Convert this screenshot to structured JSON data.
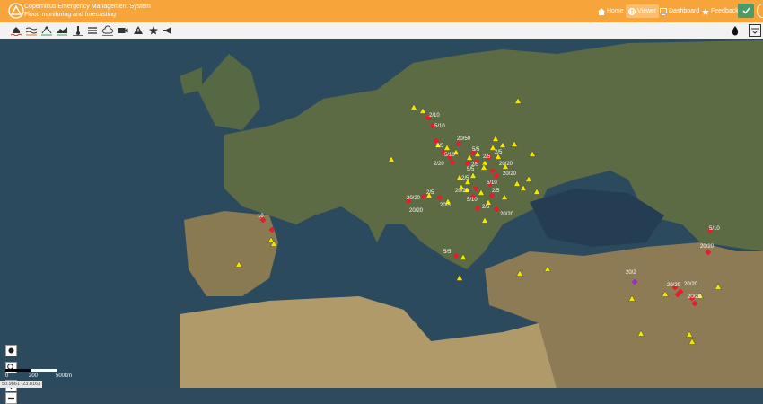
{
  "header": {
    "title": "Copernicus Emergency Management System",
    "subtitle": "Flood monitoring and forecasting",
    "nav": [
      {
        "label": "Home",
        "icon": "home-icon"
      },
      {
        "label": "Viewer",
        "icon": "globe-icon"
      },
      {
        "label": "Dashboard",
        "icon": "monitor-icon"
      },
      {
        "label": "Feedback",
        "icon": "star-icon"
      }
    ],
    "colors": {
      "header_bg": "#f7a53a",
      "check_bg": "#4c9a66"
    }
  },
  "toolbar": {
    "icons": [
      "flood-icon",
      "waves-icon",
      "radar-icon",
      "landslide-icon",
      "thermometer-icon",
      "layers-list-icon",
      "cloud-icon",
      "camera-icon",
      "warning-icon",
      "favorite-star-icon",
      "megaphone-icon",
      "water-drop-icon",
      "legend-icon"
    ]
  },
  "map": {
    "scale_labels": [
      "0",
      "200",
      "500km"
    ],
    "coordinates": "50.9861 -23.8163",
    "marker_labels": [
      "10",
      "2/10",
      "5/10",
      "20/50",
      "2/5",
      "5/10",
      "2/20",
      "5/5",
      "2/5",
      "20/20",
      "2/5",
      "20/20",
      "2/5",
      "5/10",
      "2/5",
      "5/10",
      "2/5",
      "20/20",
      "20/20",
      "2/5",
      "20/5",
      "5/5",
      "5/10",
      "20/20",
      "20/2",
      "20/20",
      "20/20",
      "20/20",
      "2/5",
      "5/5",
      "20/20",
      "20/20"
    ],
    "colors": {
      "warning_yellow": "#f2e600",
      "alert_red": "#e0202a",
      "severe_purple": "#9b2ec8"
    }
  }
}
